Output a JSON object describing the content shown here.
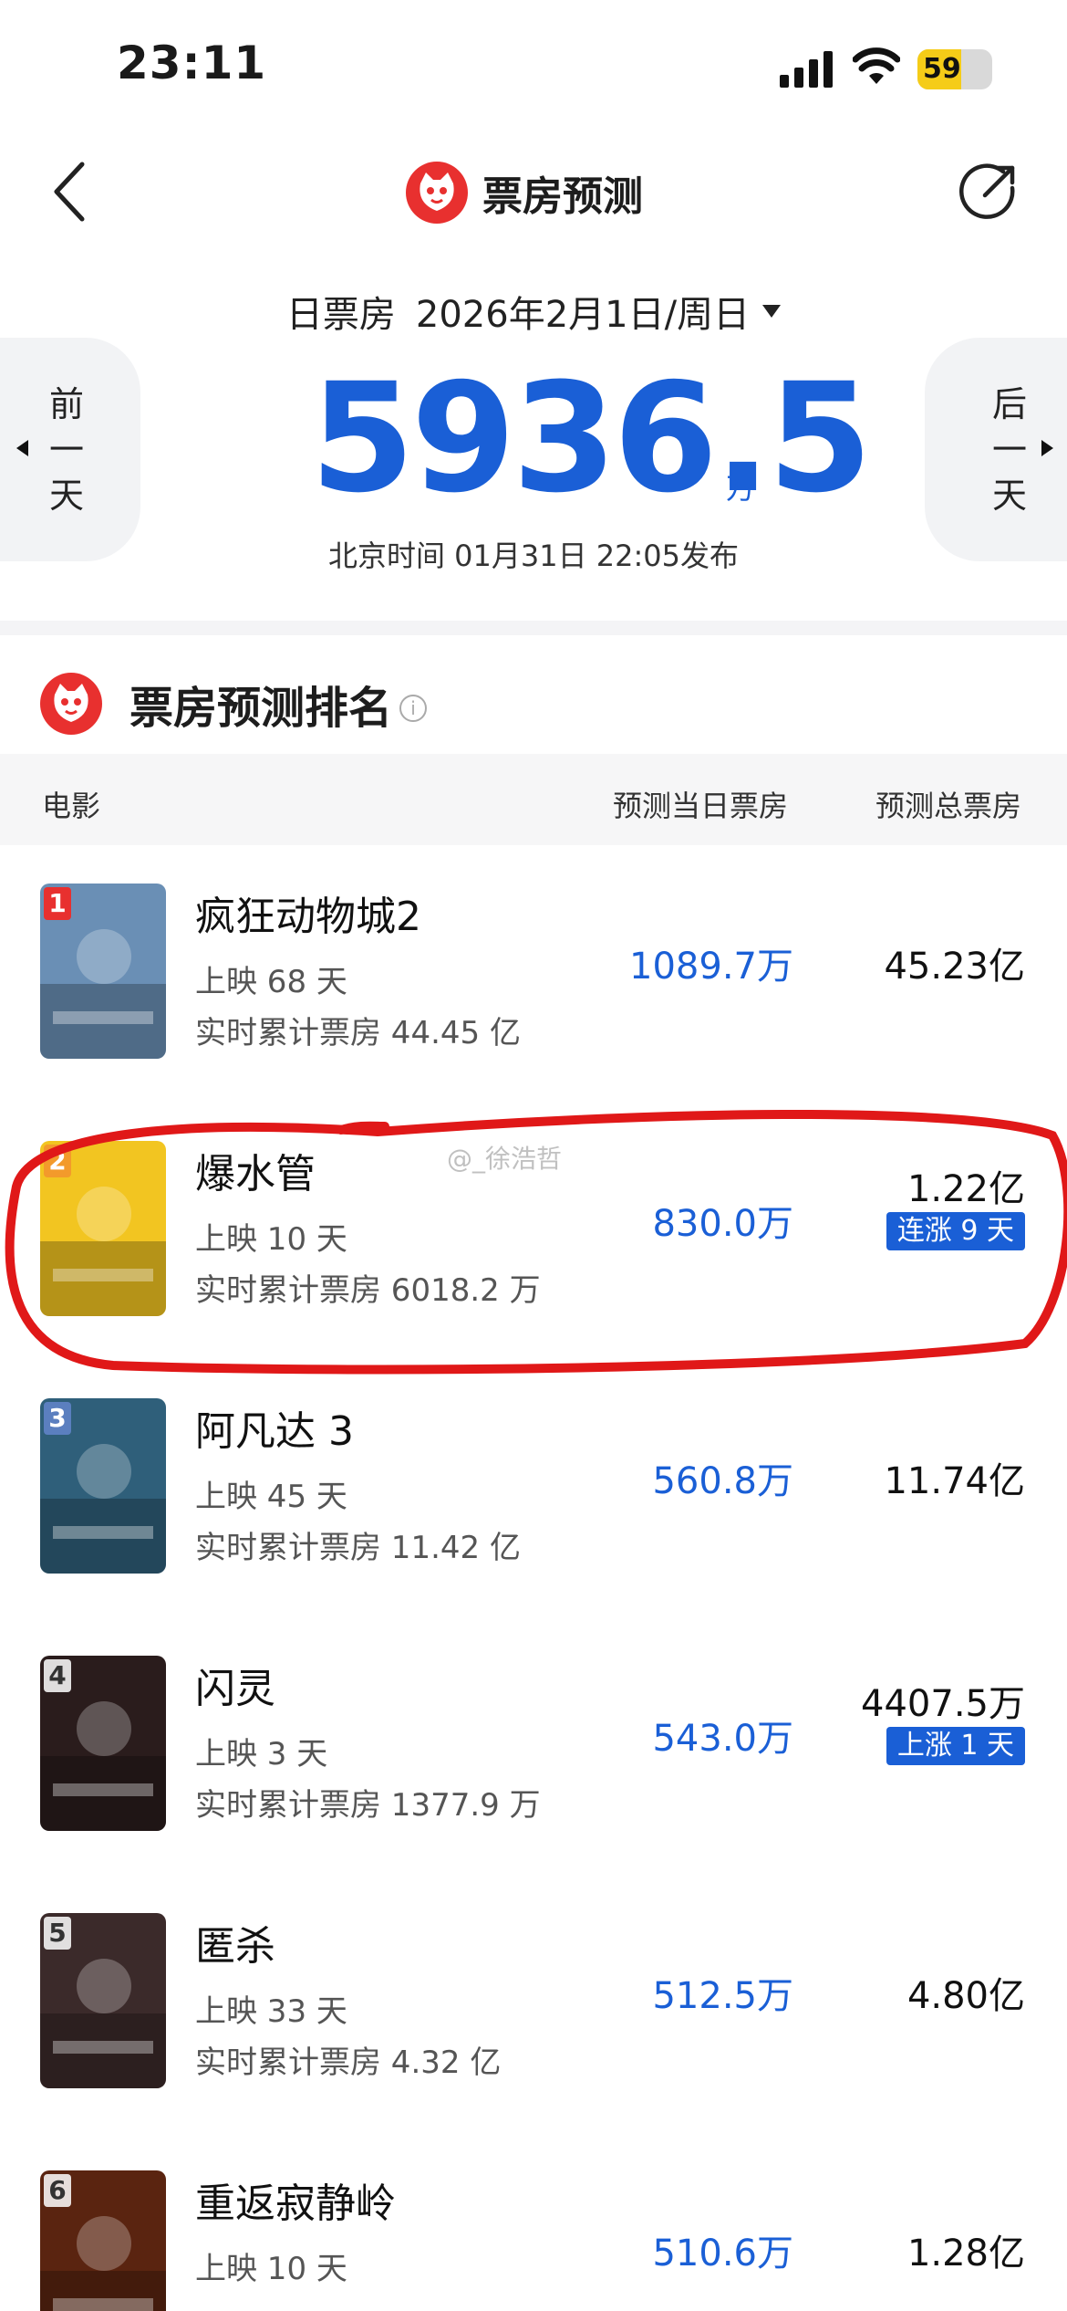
{
  "status_bar": {
    "time": "23:11",
    "battery": "59",
    "battery_level": 0.59
  },
  "nav": {
    "title": "票房预测"
  },
  "date": {
    "kind": "日票房",
    "value": "2026年2月1日/周日"
  },
  "day_nav": {
    "prev": [
      "前",
      "一",
      "天"
    ],
    "next": [
      "后",
      "一",
      "天"
    ]
  },
  "box_office": {
    "value": "5936.5",
    "unit": "万",
    "publish": "北京时间  01月31日  22:05发布"
  },
  "ranking": {
    "title": "票房预测排名",
    "columns": {
      "movie": "电影",
      "day": "预测当日票房",
      "total": "预测总票房"
    },
    "rows": [
      {
        "rank": "1",
        "name": "疯狂动物城2",
        "days": "上映 68 天",
        "cum": "实时累计票房 44.45 亿",
        "day": "1089.7万",
        "total": "45.23亿",
        "trend": "",
        "poster_color": "#6a8fb5"
      },
      {
        "rank": "2",
        "name": "爆水管",
        "days": "上映 10 天",
        "cum": "实时累计票房 6018.2 万",
        "day": "830.0万",
        "total": "1.22亿",
        "trend": "连涨 9 天",
        "poster_color": "#f2c521"
      },
      {
        "rank": "3",
        "name": "阿凡达 3",
        "days": "上映 45 天",
        "cum": "实时累计票房 11.42 亿",
        "day": "560.8万",
        "total": "11.74亿",
        "trend": "",
        "poster_color": "#2f5f7a"
      },
      {
        "rank": "4",
        "name": "闪灵",
        "days": "上映 3 天",
        "cum": "实时累计票房 1377.9 万",
        "day": "543.0万",
        "total": "4407.5万",
        "trend": "上涨 1 天",
        "poster_color": "#2a1c1c"
      },
      {
        "rank": "5",
        "name": "匿杀",
        "days": "上映 33 天",
        "cum": "实时累计票房 4.32 亿",
        "day": "512.5万",
        "total": "4.80亿",
        "trend": "",
        "poster_color": "#3b2a2a"
      },
      {
        "rank": "6",
        "name": "重返寂静岭",
        "days": "上映 10 天",
        "cum": "",
        "day": "510.6万",
        "total": "1.28亿",
        "trend": "",
        "poster_color": "#5a2410"
      }
    ]
  },
  "watermark": "@_徐浩哲"
}
